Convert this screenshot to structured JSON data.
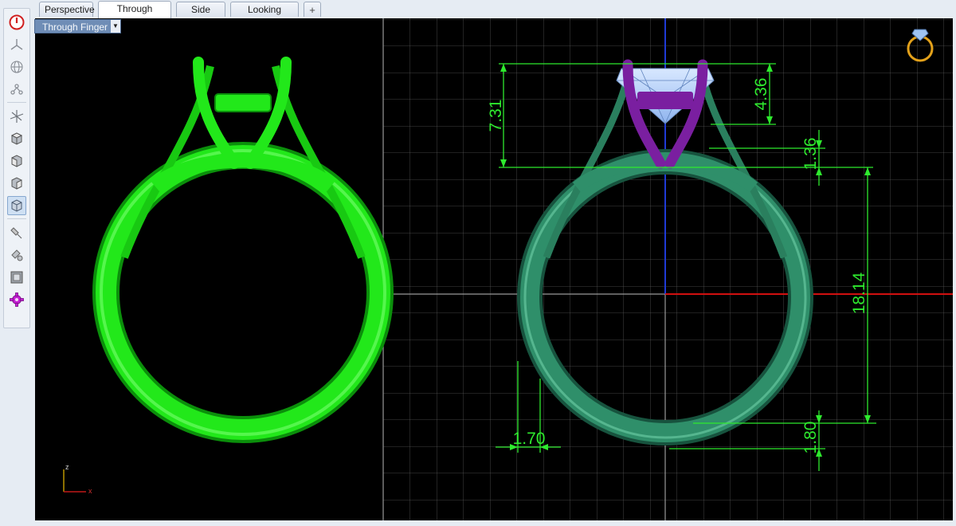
{
  "tabs": [
    {
      "label": "Perspective",
      "active": false
    },
    {
      "label": "Through Finger",
      "active": true
    },
    {
      "label": "Side View",
      "active": false
    },
    {
      "label": "Looking Down",
      "active": false
    }
  ],
  "add_tab_label": "+",
  "viewport": {
    "label": "Through Finger",
    "axis_z": "z",
    "axis_x": "x"
  },
  "dimensions": {
    "top_height": "7.31",
    "stone_height": "4.36",
    "shoulder_gap": "1.36",
    "ring_height": "18.14",
    "shank_thickness_side": "1.70",
    "shank_thickness_bottom": "1.80"
  },
  "toolbar_icons": [
    "power-icon",
    "tripod-icon",
    "globe-icon",
    "snap-icon",
    "axis-gizmo-icon",
    "box-top-icon",
    "box-front-icon",
    "box-side-icon",
    "box-iso-icon",
    "light-icon",
    "render-icon",
    "display-mode-icon",
    "settings-gear-icon"
  ],
  "colors": {
    "ring_left": "#22e81a",
    "ring_right": "#2f8f6a",
    "prongs_right": "#7a1fa0",
    "gem": "#a9c8f5",
    "dimension": "#2eea2e",
    "background": "#000000",
    "grid": "#5a5a5a"
  }
}
